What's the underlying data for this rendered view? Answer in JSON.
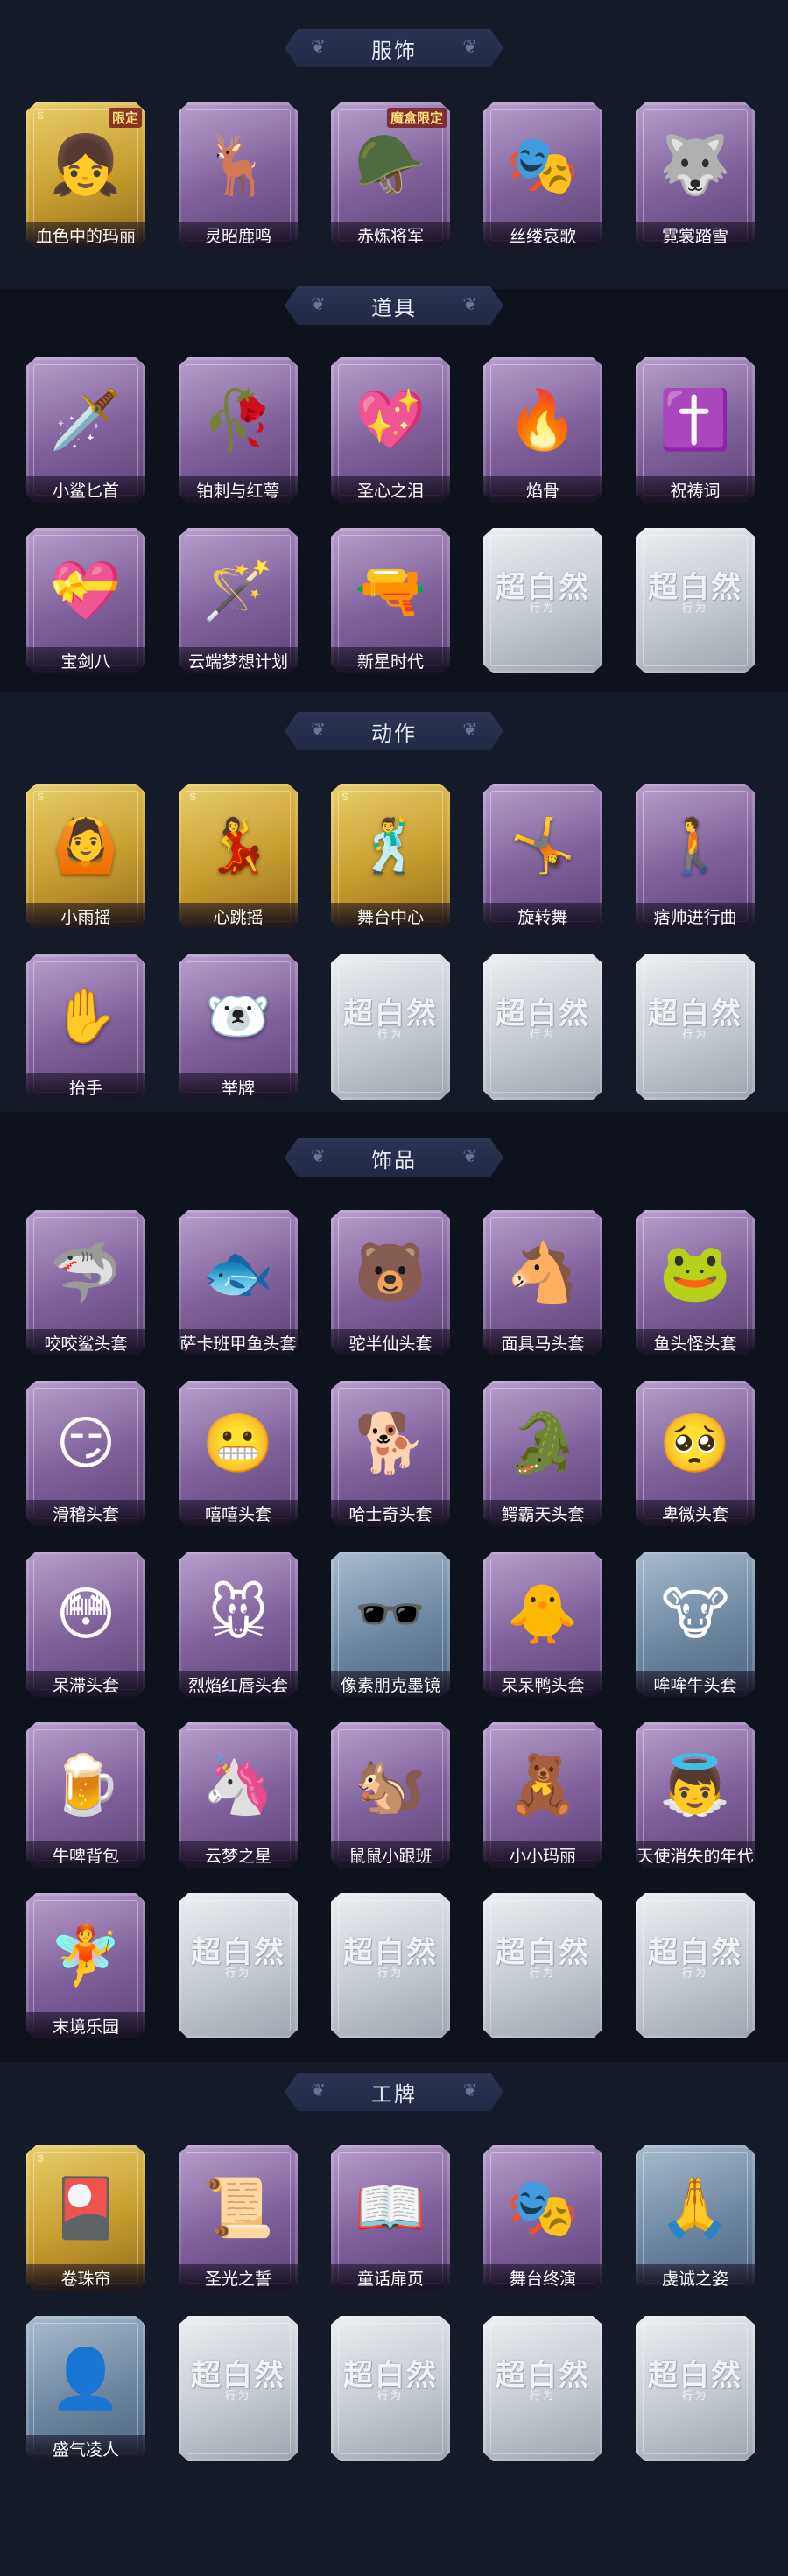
{
  "sections": [
    {
      "title": "服饰",
      "items": [
        {
          "label": "血色中的玛丽",
          "rarity": "gold",
          "icon": "👧",
          "tag": "限定",
          "sig": "S"
        },
        {
          "label": "灵昭鹿鸣",
          "rarity": "purple",
          "icon": "🦌",
          "tag": "",
          "sig": ""
        },
        {
          "label": "赤炼将军",
          "rarity": "purple",
          "icon": "🪖",
          "tag": "魔盒限定",
          "sig": ""
        },
        {
          "label": "丝缕哀歌",
          "rarity": "purple",
          "icon": "🎭",
          "tag": "",
          "sig": ""
        },
        {
          "label": "霓裳踏雪",
          "rarity": "purple",
          "icon": "🐺",
          "tag": "",
          "sig": ""
        }
      ]
    },
    {
      "title": "道具",
      "items": [
        {
          "label": "小鲨匕首",
          "rarity": "purple",
          "icon": "🗡️"
        },
        {
          "label": "铂刺与红萼",
          "rarity": "purple",
          "icon": "🥀"
        },
        {
          "label": "圣心之泪",
          "rarity": "purple",
          "icon": "💖"
        },
        {
          "label": "焰骨",
          "rarity": "purple",
          "icon": "🔥"
        },
        {
          "label": "祝祷词",
          "rarity": "purple",
          "icon": "✝️"
        },
        {
          "label": "宝剑八",
          "rarity": "purple",
          "icon": "💝"
        },
        {
          "label": "云端梦想计划",
          "rarity": "purple",
          "icon": "🪄"
        },
        {
          "label": "新星时代",
          "rarity": "purple",
          "icon": "🔫"
        },
        {
          "label": "",
          "rarity": "silver",
          "icon": "",
          "placeholder": "超白然",
          "placeholder_sub": "行为"
        },
        {
          "label": "",
          "rarity": "silver",
          "icon": "",
          "placeholder": "超白然",
          "placeholder_sub": "行为"
        }
      ]
    },
    {
      "title": "动作",
      "items": [
        {
          "label": "小雨摇",
          "rarity": "gold",
          "icon": "🙆",
          "sig": "S"
        },
        {
          "label": "心跳摇",
          "rarity": "gold",
          "icon": "💃",
          "sig": "S"
        },
        {
          "label": "舞台中心",
          "rarity": "gold",
          "icon": "🕺",
          "sig": "S"
        },
        {
          "label": "旋转舞",
          "rarity": "purple",
          "icon": "🤸"
        },
        {
          "label": "痞帅进行曲",
          "rarity": "purple",
          "icon": "🚶"
        },
        {
          "label": "抬手",
          "rarity": "purple",
          "icon": "✋"
        },
        {
          "label": "举牌",
          "rarity": "purple",
          "icon": "🐻‍❄️"
        },
        {
          "label": "",
          "rarity": "silver",
          "icon": "",
          "placeholder": "超白然",
          "placeholder_sub": "行为"
        },
        {
          "label": "",
          "rarity": "silver",
          "icon": "",
          "placeholder": "超白然",
          "placeholder_sub": "行为"
        },
        {
          "label": "",
          "rarity": "silver",
          "icon": "",
          "placeholder": "超白然",
          "placeholder_sub": "行为"
        }
      ]
    },
    {
      "title": "饰品",
      "items": [
        {
          "label": "咬咬鲨头套",
          "rarity": "purple",
          "icon": "🦈"
        },
        {
          "label": "萨卡班甲鱼头套",
          "rarity": "purple",
          "icon": "🐟"
        },
        {
          "label": "驼半仙头套",
          "rarity": "purple",
          "icon": "🐻"
        },
        {
          "label": "面具马头套",
          "rarity": "purple",
          "icon": "🐴"
        },
        {
          "label": "鱼头怪头套",
          "rarity": "purple",
          "icon": "🐸"
        },
        {
          "label": "滑稽头套",
          "rarity": "purple",
          "icon": "😏"
        },
        {
          "label": "嘻嘻头套",
          "rarity": "purple",
          "icon": "😬"
        },
        {
          "label": "哈士奇头套",
          "rarity": "purple",
          "icon": "🐕"
        },
        {
          "label": "鳄霸天头套",
          "rarity": "purple",
          "icon": "🐊"
        },
        {
          "label": "卑微头套",
          "rarity": "purple",
          "icon": "🥺"
        },
        {
          "label": "呆滞头套",
          "rarity": "purple",
          "icon": "😳"
        },
        {
          "label": "烈焰红唇头套",
          "rarity": "purple",
          "icon": "🐭"
        },
        {
          "label": "像素朋克墨镜",
          "rarity": "blue",
          "icon": "🕶️"
        },
        {
          "label": "呆呆鸭头套",
          "rarity": "purple",
          "icon": "🐥"
        },
        {
          "label": "哞哞牛头套",
          "rarity": "blue",
          "icon": "🐮"
        },
        {
          "label": "牛啤背包",
          "rarity": "purple",
          "icon": "🍺"
        },
        {
          "label": "云梦之星",
          "rarity": "purple",
          "icon": "🦄"
        },
        {
          "label": "鼠鼠小跟班",
          "rarity": "purple",
          "icon": "🐿️"
        },
        {
          "label": "小小玛丽",
          "rarity": "purple",
          "icon": "🧸"
        },
        {
          "label": "天使消失的年代",
          "rarity": "purple",
          "icon": "👼"
        },
        {
          "label": "末境乐园",
          "rarity": "purple",
          "icon": "🧚"
        },
        {
          "label": "",
          "rarity": "silver",
          "icon": "",
          "placeholder": "超白然",
          "placeholder_sub": "行为"
        },
        {
          "label": "",
          "rarity": "silver",
          "icon": "",
          "placeholder": "超白然",
          "placeholder_sub": "行为"
        },
        {
          "label": "",
          "rarity": "silver",
          "icon": "",
          "placeholder": "超白然",
          "placeholder_sub": "行为"
        },
        {
          "label": "",
          "rarity": "silver",
          "icon": "",
          "placeholder": "超白然",
          "placeholder_sub": "行为"
        }
      ]
    },
    {
      "title": "工牌",
      "items": [
        {
          "label": "卷珠帘",
          "rarity": "gold",
          "icon": "🎴",
          "sig": "S"
        },
        {
          "label": "圣光之誓",
          "rarity": "purple",
          "icon": "📜"
        },
        {
          "label": "童话扉页",
          "rarity": "purple",
          "icon": "📖"
        },
        {
          "label": "舞台终演",
          "rarity": "purple",
          "icon": "🎭"
        },
        {
          "label": "虔诚之姿",
          "rarity": "blue",
          "icon": "🙏"
        },
        {
          "label": "盛气凌人",
          "rarity": "blue",
          "icon": "👤"
        },
        {
          "label": "",
          "rarity": "silver",
          "icon": "",
          "placeholder": "超白然",
          "placeholder_sub": "行为"
        },
        {
          "label": "",
          "rarity": "silver",
          "icon": "",
          "placeholder": "超白然",
          "placeholder_sub": "行为"
        },
        {
          "label": "",
          "rarity": "silver",
          "icon": "",
          "placeholder": "超白然",
          "placeholder_sub": "行为"
        },
        {
          "label": "",
          "rarity": "silver",
          "icon": "",
          "placeholder": "超白然",
          "placeholder_sub": "行为"
        }
      ]
    }
  ]
}
